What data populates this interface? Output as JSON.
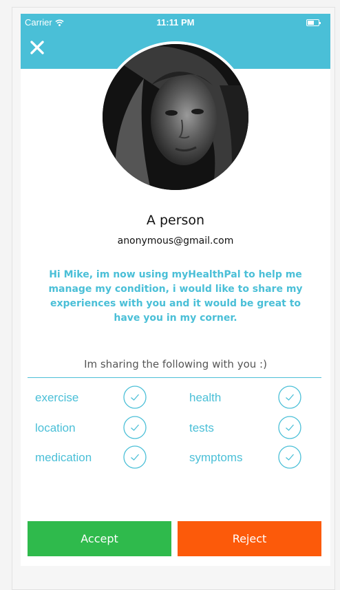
{
  "status_bar": {
    "carrier": "Carrier",
    "time": "11:11 PM"
  },
  "colors": {
    "accent": "#4abfd7",
    "accept": "#2fba4c",
    "reject": "#fc5a0a"
  },
  "profile": {
    "name": "A person",
    "email": "anonymous@gmail.com"
  },
  "message": "Hi Mike, im now using myHealthPal to help me manage my condition, i would like to share my experiences with you and it would be great to have you in my corner.",
  "share_heading": "Im sharing the following with you :)",
  "share_items": [
    {
      "label": "exercise",
      "checked": true
    },
    {
      "label": "health",
      "checked": true
    },
    {
      "label": "location",
      "checked": true
    },
    {
      "label": "tests",
      "checked": true
    },
    {
      "label": "medication",
      "checked": true
    },
    {
      "label": "symptoms",
      "checked": true
    }
  ],
  "actions": {
    "accept_label": "Accept",
    "reject_label": "Reject"
  },
  "icons": {
    "close": "close-icon",
    "wifi": "wifi-icon",
    "battery": "battery-icon",
    "check": "check-circle-icon"
  }
}
